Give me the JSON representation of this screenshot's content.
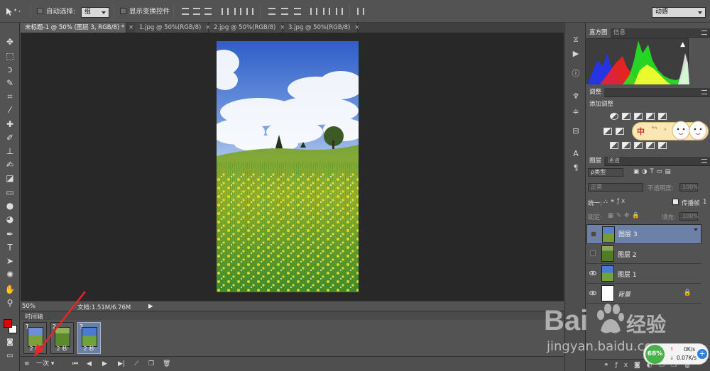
{
  "options_bar": {
    "auto_select_label": "自动选择:",
    "auto_select_value": "组",
    "show_transform_label": "显示变换控件",
    "workspace_value": "动感"
  },
  "tabs": [
    {
      "label": "未标题-1 @ 50% (图层 3, RGB/8) *",
      "active": true
    },
    {
      "label": "1.jpg @ 50%(RGB/8)",
      "active": false
    },
    {
      "label": "2.jpg @ 50%(RGB/8)",
      "active": false
    },
    {
      "label": "3.jpg @ 50%(RGB/8)",
      "active": false
    }
  ],
  "status": {
    "zoom": "50%",
    "doc_info": "文档:1.51M/6.76M"
  },
  "timeline": {
    "title": "时间轴",
    "frames": [
      {
        "num": "1",
        "duration": "2 秒"
      },
      {
        "num": "2",
        "duration": "2 秒"
      },
      {
        "num": "3",
        "duration": "2 秒"
      }
    ],
    "loop": "一次"
  },
  "histogram": {
    "tabs": [
      "直方图",
      "信息"
    ]
  },
  "adjustments": {
    "tab": "调整",
    "add_label": "添加调整"
  },
  "layers_panel": {
    "tabs": [
      "图层",
      "通道"
    ],
    "filter_label": "ρ类型",
    "blend_mode": "正常",
    "opacity_label": "不透明度:",
    "opacity_value": "100%",
    "unify_label": "统一:",
    "propagate_label": "传播帧",
    "propagate_value": "1",
    "lock_label": "锁定:",
    "fill_label": "填充:",
    "fill_value": "100%",
    "layers": [
      {
        "name": "图层 3",
        "selected": true,
        "visible": false
      },
      {
        "name": "图层 2",
        "selected": false,
        "visible": false
      },
      {
        "name": "图层 1",
        "selected": false,
        "visible": true
      },
      {
        "name": "背景",
        "selected": false,
        "visible": true
      }
    ]
  },
  "ime": {
    "label": "中"
  },
  "watermark": {
    "brand": "Bai",
    "brand2": "经验",
    "url": "jingyan.baidu.com"
  },
  "net_widget": {
    "percent": "68%",
    "up": "0K/s",
    "down": "0.07K/s"
  },
  "colors": {
    "foreground": "#e00000",
    "background": "#ffffff",
    "selected_layer": "#6d81a8",
    "arrow": "#e8262a"
  }
}
